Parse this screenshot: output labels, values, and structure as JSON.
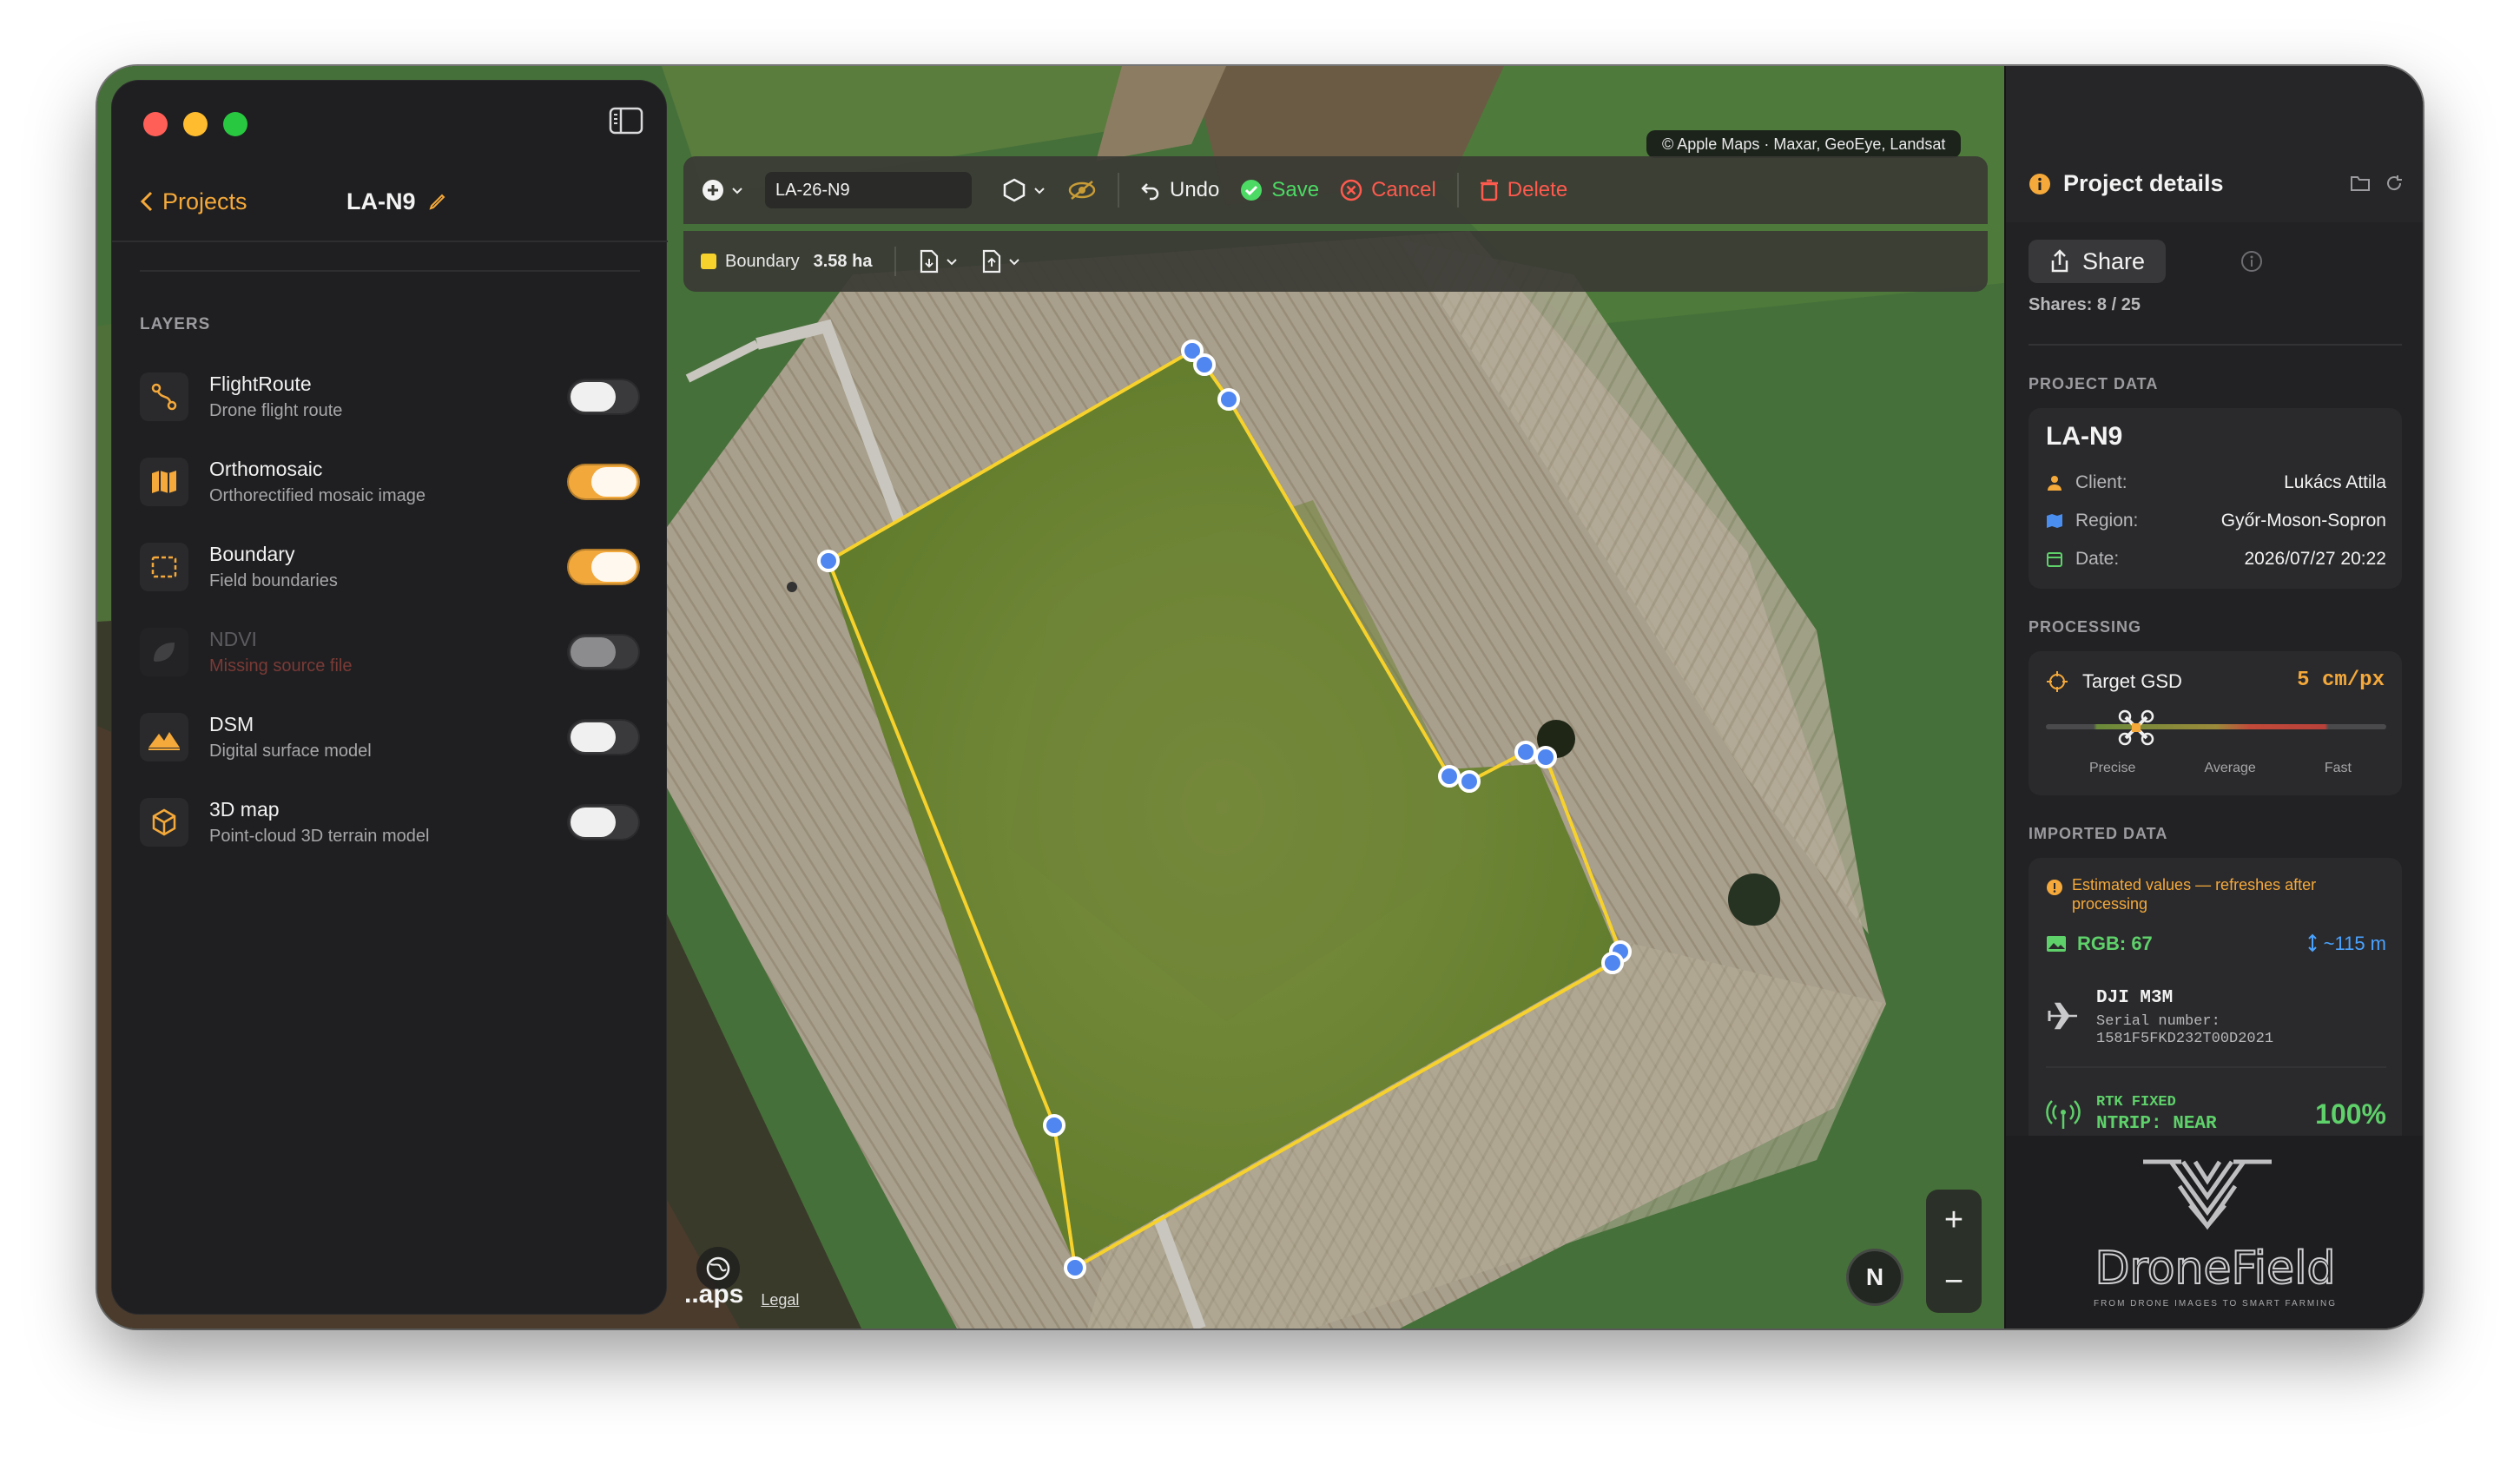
{
  "map": {
    "attribution": "© Apple Maps · Maxar, GeoEye, Landsat",
    "maps_logo": "..aps",
    "legal": "Legal",
    "compass": "N",
    "zoom_in": "+",
    "zoom_out": "−"
  },
  "toolbar": {
    "name_value": "LA-26-N9",
    "undo": "Undo",
    "save": "Save",
    "cancel": "Cancel",
    "delete": "Delete",
    "boundary_label": "Boundary",
    "boundary_area": "3.58 ha",
    "colors": {
      "save": "#4cd964",
      "danger": "#ff5a4e",
      "boundary": "#f7d22c"
    }
  },
  "sidebar": {
    "back": "Projects",
    "project_name": "LA-N9",
    "layers_title": "LAYERS",
    "layers": [
      {
        "name": "FlightRoute",
        "desc": "Drone flight route",
        "icon": "route-icon",
        "enabled": false,
        "available": true
      },
      {
        "name": "Orthomosaic",
        "desc": "Orthorectified mosaic image",
        "icon": "map-icon",
        "enabled": true,
        "available": true
      },
      {
        "name": "Boundary",
        "desc": "Field boundaries",
        "icon": "boundary-icon",
        "enabled": true,
        "available": true
      },
      {
        "name": "NDVI",
        "desc": "Missing source file",
        "icon": "leaf-icon",
        "enabled": false,
        "available": false
      },
      {
        "name": "DSM",
        "desc": "Digital surface model",
        "icon": "mountain-icon",
        "enabled": false,
        "available": true
      },
      {
        "name": "3D map",
        "desc": "Point-cloud 3D terrain model",
        "icon": "cube-icon",
        "enabled": false,
        "available": true
      }
    ],
    "accent": "#f5a93a"
  },
  "panel": {
    "title": "Project details",
    "share": "Share",
    "shares": "Shares: 8 / 25",
    "project_data_title": "PROJECT DATA",
    "project": {
      "name": "LA-N9",
      "client_label": "Client:",
      "client": "Lukács Attila",
      "region_label": "Region:",
      "region": "Győr-Moson-Sopron",
      "date_label": "Date:",
      "date": "2026/07/27 20:22"
    },
    "processing_title": "PROCESSING",
    "gsd_label": "Target GSD",
    "gsd_value": "5 cm/px",
    "gsd_ticks": [
      "Precise",
      "Average",
      "Fast"
    ],
    "imported_title": "IMPORTED DATA",
    "warning": "Estimated values — refreshes after processing",
    "rgb": "RGB: 67",
    "altitude": "~115 m",
    "drone": "DJI M3M",
    "serial_label": "Serial number:",
    "serial": "1581F5FKD232T00D2021",
    "rtk_status": "RTK FIXED",
    "ntrip": "NTRIP: NEAR",
    "rtk_pct": "100%",
    "brand_name": "DroneField",
    "brand_tagline": "FROM DRONE IMAGES TO SMART FARMING"
  }
}
